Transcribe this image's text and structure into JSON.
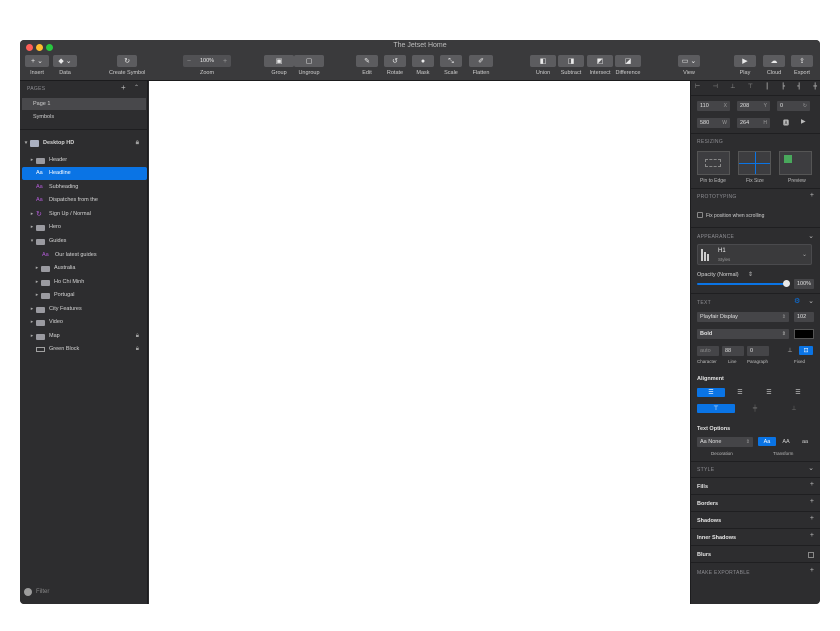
{
  "window": {
    "title": "The Jetset Home"
  },
  "colors": {
    "accent": "#0a74e5",
    "text_layer": "#b45bd9",
    "close": "#fe5f57",
    "minimize": "#febc2e",
    "zoom": "#28c840"
  },
  "toolbar": {
    "insert": "Insert",
    "data": "Data",
    "create_symbol": "Create Symbol",
    "zoom_value": "100%",
    "zoom": "Zoom",
    "group": "Group",
    "ungroup": "Ungroup",
    "edit": "Edit",
    "rotate": "Rotate",
    "mask": "Mask",
    "scale": "Scale",
    "flatten": "Flatten",
    "union": "Union",
    "subtract": "Subtract",
    "intersect": "Intersect",
    "difference": "Difference",
    "view": "View",
    "play": "Play",
    "cloud": "Cloud",
    "export": "Export"
  },
  "pages": {
    "header": "PAGES",
    "items": [
      "Page 1",
      "Symbols"
    ]
  },
  "artboard": {
    "name": "Desktop HD"
  },
  "layers": [
    {
      "label": "Header"
    },
    {
      "label": "Headline"
    },
    {
      "label": "Subheading"
    },
    {
      "label": "Dispatches from the"
    },
    {
      "label": "Sign Up / Normal"
    },
    {
      "label": "Hero"
    },
    {
      "label": "Guides"
    },
    {
      "label": "Our latest guides"
    },
    {
      "label": "Australia"
    },
    {
      "label": "Ho Chi Minh"
    },
    {
      "label": "Portugal"
    },
    {
      "label": "City Features"
    },
    {
      "label": "Video"
    },
    {
      "label": "Map"
    },
    {
      "label": "Green Block"
    }
  ],
  "filter": "Filter",
  "inspector": {
    "x": "110",
    "y": "208",
    "rotation": "0",
    "w": "580",
    "h": "264",
    "x_suffix": "X",
    "y_suffix": "Y",
    "w_suffix": "W",
    "h_suffix": "H",
    "resizing": "RESIZING",
    "pin_to_edge": "Pin to Edge",
    "fix_size": "Fix Size",
    "preview": "Preview",
    "prototyping": "PROTOTYPING",
    "fix_position": "Fix position when scrolling",
    "appearance": "APPEARANCE",
    "style_name": "H1",
    "style_sub": "Styles",
    "opacity_label": "Opacity (Normal)",
    "opacity_value": "100%",
    "text": "TEXT",
    "font": "Playfair Display",
    "font_size": "102",
    "weight": "Bold",
    "character": "auto",
    "line": "88",
    "paragraph": "0",
    "character_label": "Character",
    "line_label": "Line",
    "paragraph_label": "Paragraph",
    "fixed_label": "Fixed",
    "alignment": "Alignment",
    "text_options": "Text Options",
    "decoration_value": "Aa None",
    "decoration": "Decoration",
    "transform": "Transform",
    "tf_aa1": "Aa",
    "tf_aa2": "AA",
    "tf_lower": "aa",
    "style": "STYLE",
    "fills": "Fills",
    "borders": "Borders",
    "shadows": "Shadows",
    "inner_shadows": "Inner Shadows",
    "blurs": "Blurs",
    "make_exportable": "MAKE EXPORTABLE"
  }
}
